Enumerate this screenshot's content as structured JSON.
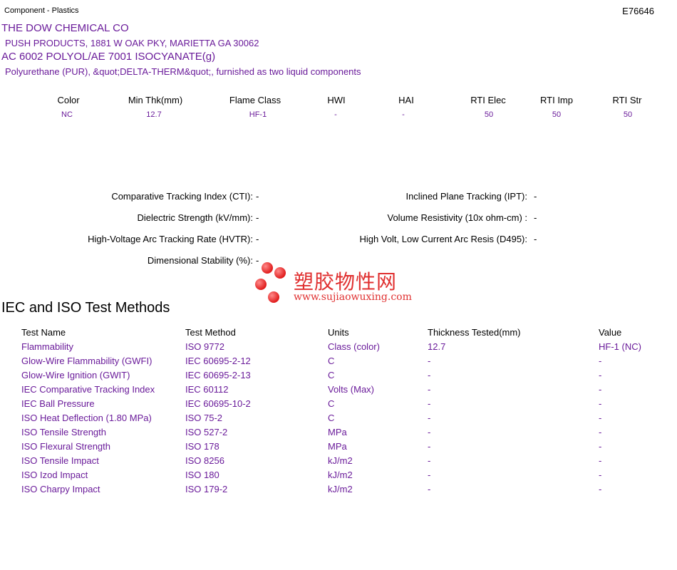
{
  "header": {
    "category": "Component - Plastics",
    "file_number": "E76646",
    "company": "THE DOW CHEMICAL CO",
    "address": "PUSH PRODUCTS, 1881 W OAK PKY, MARIETTA GA   30062",
    "product": "AC 6002 POLYOL/AE 7001 ISOCYANATE(g)",
    "description": "Polyurethane (PUR), &quot;DELTA-THERM&quot;, furnished as two liquid components"
  },
  "properties": {
    "columns": [
      "Color",
      "Min Thk(mm)",
      "Flame Class",
      "HWI",
      "HAI",
      "RTI Elec",
      "RTI Imp",
      "RTI Str"
    ],
    "values": [
      "NC",
      "12.7",
      "HF-1",
      "-",
      "-",
      "50",
      "50",
      "50"
    ]
  },
  "electrical": {
    "left": [
      {
        "label": "Comparative Tracking Index (CTI):",
        "value": "-"
      },
      {
        "label": "Dielectric Strength (kV/mm):",
        "value": "-"
      },
      {
        "label": "High-Voltage Arc Tracking Rate (HVTR):",
        "value": "-"
      },
      {
        "label": "Dimensional Stability (%):",
        "value": "-"
      }
    ],
    "right": [
      {
        "label": "Inclined Plane Tracking (IPT):",
        "value": "-"
      },
      {
        "label": "Volume Resistivity (10x ohm-cm) :",
        "value": "-"
      },
      {
        "label": "High Volt, Low Current Arc Resis (D495):",
        "value": "-"
      }
    ]
  },
  "watermark": {
    "name": "塑胶物性网",
    "url": "www.sujiaowuxing.com"
  },
  "iso": {
    "title": "IEC and ISO Test Methods",
    "headers": [
      "Test Name",
      "Test Method",
      "Units",
      "Thickness Tested(mm)",
      "Value"
    ],
    "rows": [
      [
        "Flammability",
        "ISO 9772",
        "Class (color)",
        "12.7",
        "HF-1 (NC)"
      ],
      [
        "Glow-Wire Flammability (GWFI)",
        "IEC 60695-2-12",
        "C",
        "-",
        "-"
      ],
      [
        "Glow-Wire Ignition (GWIT)",
        "IEC 60695-2-13",
        "C",
        "-",
        "-"
      ],
      [
        "IEC Comparative Tracking Index",
        "IEC 60112",
        "Volts (Max)",
        "-",
        "-"
      ],
      [
        "IEC Ball Pressure",
        "IEC 60695-10-2",
        "C",
        "-",
        "-"
      ],
      [
        "ISO Heat Deflection (1.80 MPa)",
        "ISO 75-2",
        "C",
        "-",
        "-"
      ],
      [
        "ISO Tensile Strength",
        "ISO 527-2",
        "MPa",
        "-",
        "-"
      ],
      [
        "ISO Flexural Strength",
        "ISO 178",
        "MPa",
        "-",
        "-"
      ],
      [
        "ISO Tensile Impact",
        "ISO 8256",
        "kJ/m2",
        "-",
        "-"
      ],
      [
        "ISO Izod Impact",
        "ISO 180",
        "kJ/m2",
        "-",
        "-"
      ],
      [
        "ISO Charpy Impact",
        "ISO 179-2",
        "kJ/m2",
        "-",
        "-"
      ]
    ]
  }
}
